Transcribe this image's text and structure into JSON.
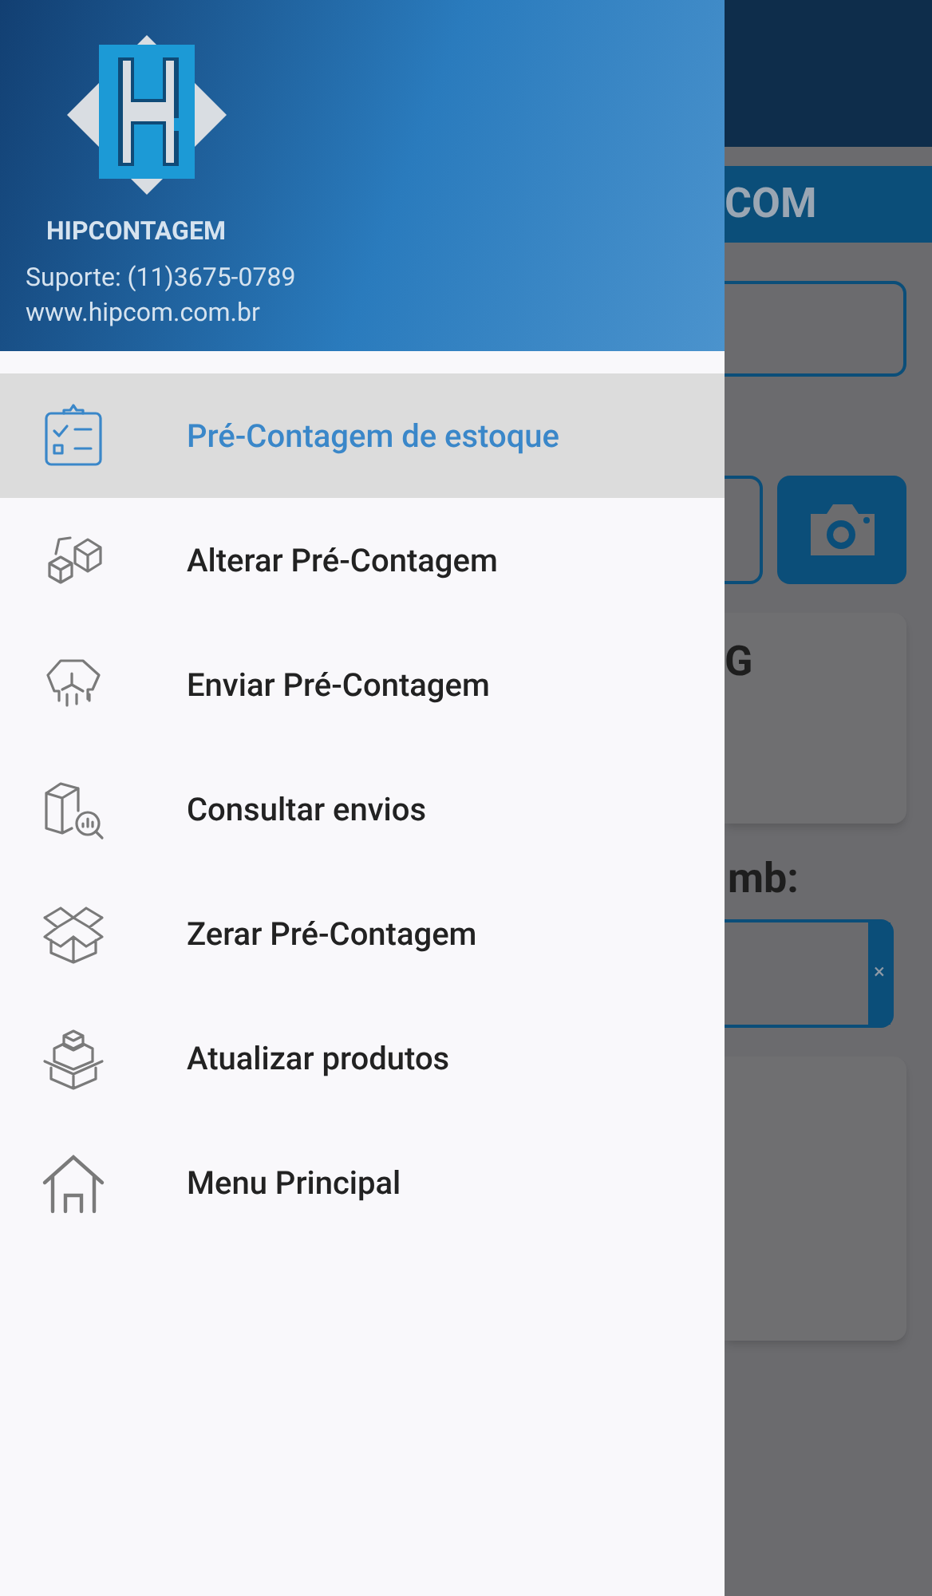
{
  "drawer": {
    "brand": "HIPCONTAGEM",
    "support": "Suporte: (11)3675-0789",
    "website": "www.hipcom.com.br",
    "items": [
      {
        "label": "Pré-Contagem de estoque",
        "kind": "clipboard",
        "selected": true
      },
      {
        "label": "Alterar Pré-Contagem",
        "kind": "boxes",
        "selected": false
      },
      {
        "label": "Enviar Pré-Contagem",
        "kind": "box-drip",
        "selected": false
      },
      {
        "label": "Consultar envios",
        "kind": "box-search",
        "selected": false
      },
      {
        "label": "Zerar Pré-Contagem",
        "kind": "open-box",
        "selected": false
      },
      {
        "label": "Atualizar produtos",
        "kind": "stacked-boxes",
        "selected": false
      },
      {
        "label": "Menu Principal",
        "kind": "house",
        "selected": false
      }
    ]
  },
  "background_screen": {
    "title": "COM",
    "card_text": "G",
    "field_label": "mb:",
    "clear_symbol": "×"
  }
}
